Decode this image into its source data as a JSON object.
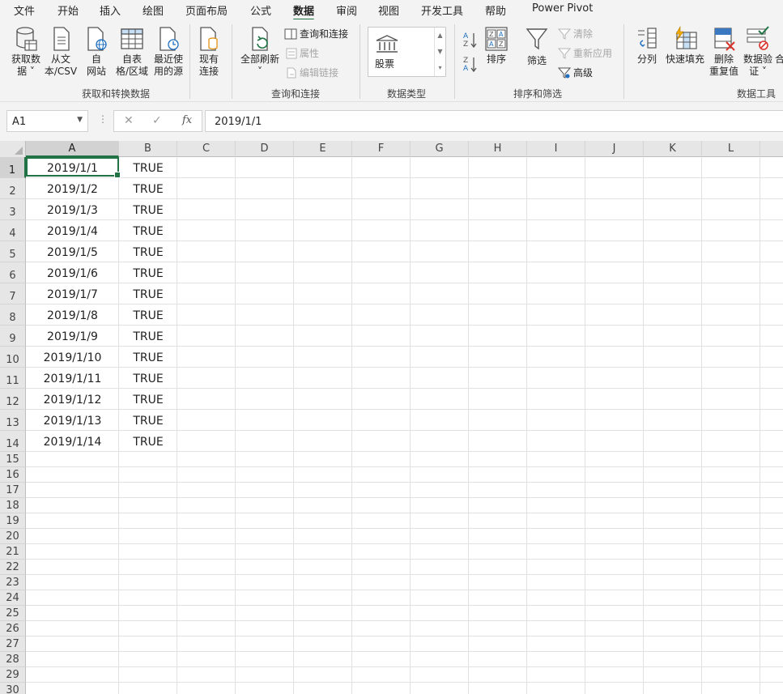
{
  "tabs": [
    {
      "label": "文件"
    },
    {
      "label": "开始"
    },
    {
      "label": "插入"
    },
    {
      "label": "绘图"
    },
    {
      "label": "页面布局"
    },
    {
      "label": "公式"
    },
    {
      "label": "数据"
    },
    {
      "label": "审阅"
    },
    {
      "label": "视图"
    },
    {
      "label": "开发工具"
    },
    {
      "label": "帮助"
    },
    {
      "label": "Power Pivot"
    }
  ],
  "active_tab": "数据",
  "ribbon": {
    "get_transform": {
      "group_label": "获取和转换数据",
      "get_data": {
        "line1": "获取数",
        "line2": "据 ˅",
        "icon": "database-icon"
      },
      "from_text": {
        "line1": "从文",
        "line2": "本/CSV",
        "icon": "text-file-icon"
      },
      "from_web": {
        "line1": "自",
        "line2": "网站",
        "icon": "web-icon"
      },
      "from_table": {
        "line1": "自表",
        "line2": "格/区域",
        "icon": "table-icon"
      },
      "recent_sources": {
        "line1": "最近使",
        "line2": "用的源",
        "icon": "recent-sources-icon"
      },
      "existing_conn": {
        "line1": "现有",
        "line2": "连接",
        "icon": "existing-connection-icon"
      }
    },
    "queries": {
      "group_label": "查询和连接",
      "refresh_all": {
        "line1": "全部刷新",
        "line2": "˅",
        "icon": "refresh-icon"
      },
      "queries_conn": "查询和连接",
      "properties": "属性",
      "edit_links": "编辑链接"
    },
    "data_types": {
      "group_label": "数据类型",
      "stock": "股票",
      "icon": "bank-icon"
    },
    "sort_filter": {
      "group_label": "排序和筛选",
      "sort": "排序",
      "filter": "筛选",
      "clear": "清除",
      "reapply": "重新应用",
      "advanced": "高级"
    },
    "data_tools": {
      "group_label": "数据工具",
      "split": "分列",
      "flash_fill": "快速填充",
      "remove_dup": {
        "line1": "删除",
        "line2": "重复值"
      },
      "validation": {
        "line1": "数据验",
        "line2": "证 ˅"
      },
      "consolidate": "合"
    }
  },
  "formula_bar": {
    "name_box": "A1",
    "cancel": "✕",
    "enter": "✓",
    "fx": "fx",
    "value": "2019/1/1"
  },
  "columns": [
    "A",
    "B",
    "C",
    "D",
    "E",
    "F",
    "G",
    "H",
    "I",
    "J",
    "K",
    "L"
  ],
  "rows": [
    "1",
    "2",
    "3",
    "4",
    "5",
    "6",
    "7",
    "8",
    "9",
    "10",
    "11",
    "12",
    "13",
    "14",
    "15",
    "16",
    "17",
    "18",
    "19",
    "20",
    "21",
    "22",
    "23",
    "24",
    "25",
    "26",
    "27",
    "28",
    "29",
    "30"
  ],
  "cells": [
    [
      "2019/1/1",
      "TRUE"
    ],
    [
      "2019/1/2",
      "TRUE"
    ],
    [
      "2019/1/3",
      "TRUE"
    ],
    [
      "2019/1/4",
      "TRUE"
    ],
    [
      "2019/1/5",
      "TRUE"
    ],
    [
      "2019/1/6",
      "TRUE"
    ],
    [
      "2019/1/7",
      "TRUE"
    ],
    [
      "2019/1/8",
      "TRUE"
    ],
    [
      "2019/1/9",
      "TRUE"
    ],
    [
      "2019/1/10",
      "TRUE"
    ],
    [
      "2019/1/11",
      "TRUE"
    ],
    [
      "2019/1/12",
      "TRUE"
    ],
    [
      "2019/1/13",
      "TRUE"
    ],
    [
      "2019/1/14",
      "TRUE"
    ]
  ],
  "colors": {
    "accent": "#217346",
    "ribbon_bg": "#f3f3f3",
    "header_bg": "#e6e6e6"
  }
}
